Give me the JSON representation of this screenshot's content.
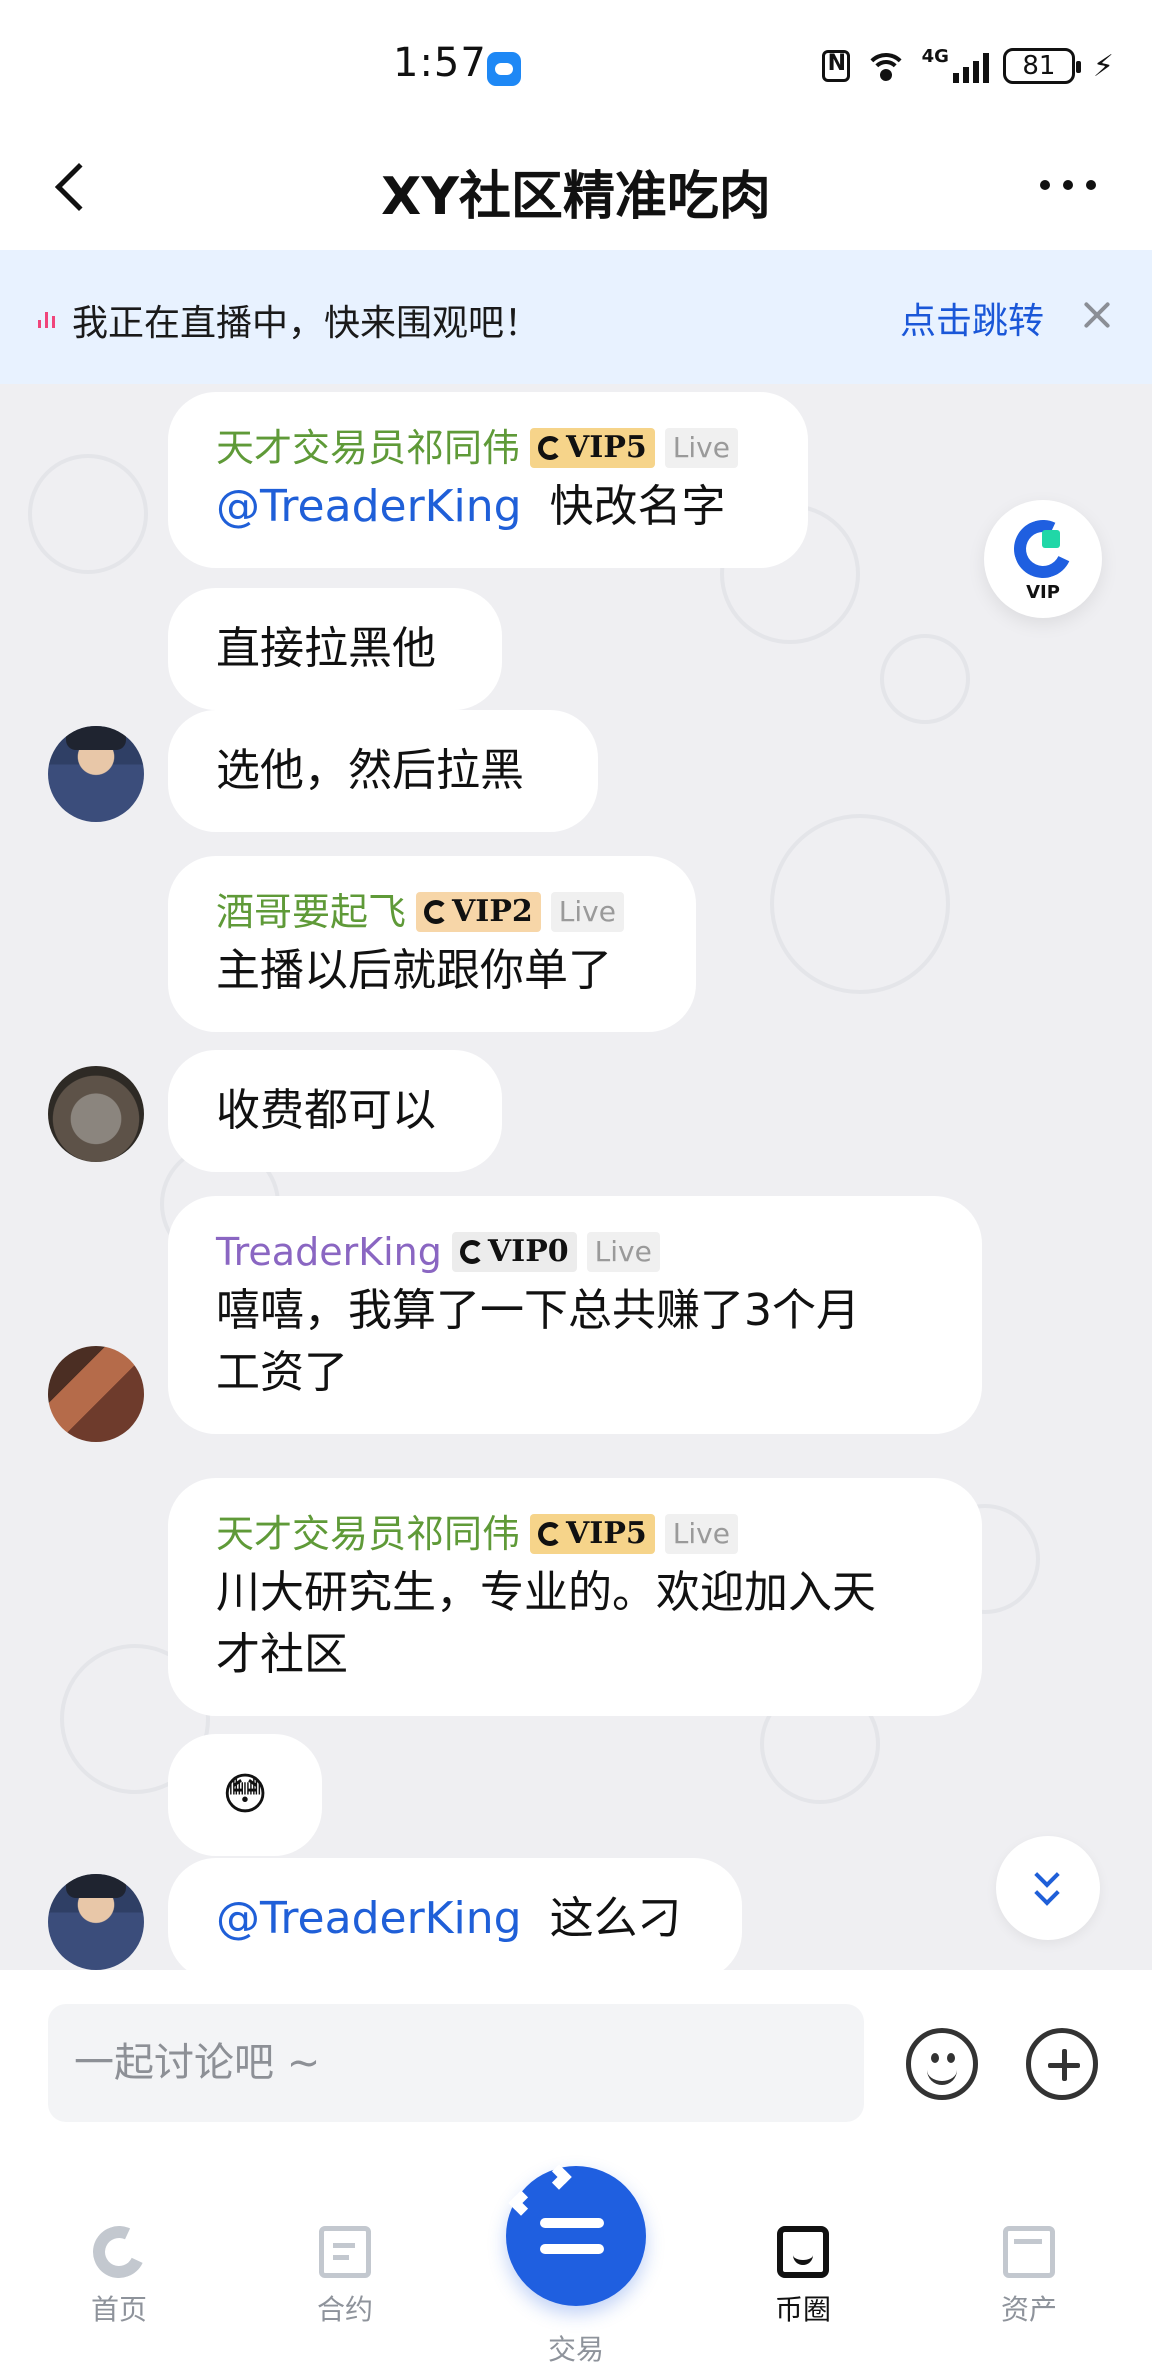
{
  "status_bar": {
    "time": "1:57",
    "network": "4G",
    "battery": "81"
  },
  "header": {
    "title": "XY社区精准吃肉"
  },
  "live_banner": {
    "text": "我正在直播中，快来围观吧！",
    "action": "点击跳转"
  },
  "floating_vip": {
    "label": "VIP"
  },
  "messages": [
    {
      "sender": "天才交易员祁同伟",
      "vip": "VIP5",
      "live": "Live",
      "mention": "@TreaderKing",
      "text": "快改名字"
    },
    {
      "text": "直接拉黑他"
    },
    {
      "text": "选他，然后拉黑"
    },
    {
      "sender": "酒哥要起飞",
      "vip": "VIP2",
      "live": "Live",
      "text": "主播以后就跟你单了"
    },
    {
      "text": "收费都可以"
    },
    {
      "sender": "TreaderKing",
      "vip": "VIP0",
      "live": "Live",
      "text_line_1": "嘻嘻，我算了一下总共赚了3个月",
      "text_line_2": "工资了"
    },
    {
      "sender": "天才交易员祁同伟",
      "vip": "VIP5",
      "live": "Live",
      "text_line_1": "川大研究生，专业的。欢迎加入天",
      "text_line_2": "才社区"
    },
    {
      "text": "😳"
    },
    {
      "mention": "@TreaderKing",
      "text": "这么刁"
    }
  ],
  "input": {
    "placeholder": "一起讨论吧 ~"
  },
  "bottom_nav": {
    "home": "首页",
    "contract": "合约",
    "trade": "交易",
    "circle": "币圈",
    "assets": "资产"
  },
  "colors": {
    "accent_blue": "#1f5fe0",
    "green_name": "#5f9a38",
    "purple_name": "#8a66c2",
    "banner_bg": "#e8f2ff"
  }
}
